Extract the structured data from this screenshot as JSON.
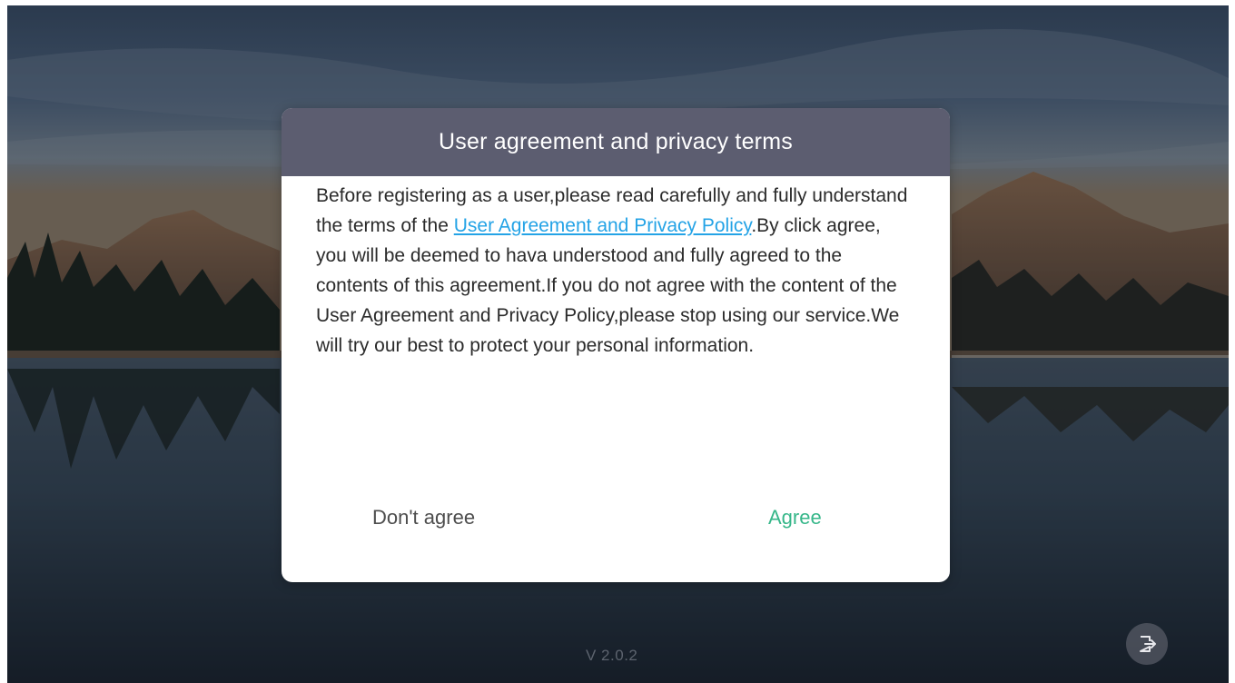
{
  "dialog": {
    "title": "User agreement and privacy terms",
    "body_intro": "Before registering as a user,please read carefully and fully understand the terms of the ",
    "link_text": "User Agreement and Privacy Policy",
    "body_rest": ".By click agree, you will be deemed to hava understood and fully agreed to the contents of this agreement.If you do not agree with the content of the User Agreement and Privacy Policy,please stop using our service.We will try our best to protect your personal information.",
    "disagree_label": "Don't agree",
    "agree_label": "Agree"
  },
  "footer": {
    "version": "V 2.0.2"
  },
  "icons": {
    "logout": "logout-icon"
  },
  "colors": {
    "header_bg": "#5c5d70",
    "link": "#24a3e6",
    "agree": "#37b78a"
  }
}
